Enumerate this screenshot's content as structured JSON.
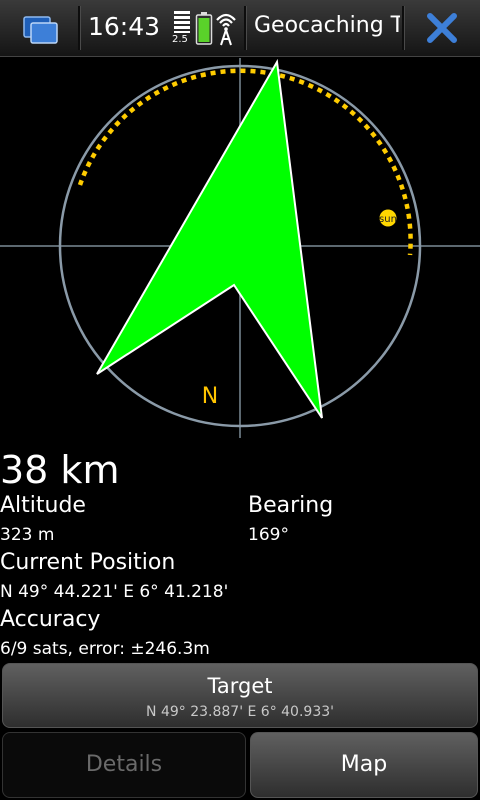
{
  "status_bar": {
    "time": "16:43",
    "signal_label": "2.5",
    "app_title": "Geocaching Too",
    "icons": [
      "task-switcher-icon",
      "signal-strength-icon",
      "battery-icon",
      "wifi-icon",
      "close-icon"
    ],
    "accent_color": "#3d7fd8",
    "battery_color": "#5ad22a"
  },
  "compass": {
    "north_label": "N",
    "sun_label": "sun",
    "arrow_color": "#00ff00",
    "ring_color": "#8a9aa8",
    "satellite_arc_color": "#ffcc00",
    "north_color": "#ffc400"
  },
  "info": {
    "distance": "38 km",
    "altitude_label": "Altitude",
    "altitude_value": "323 m",
    "bearing_label": "Bearing",
    "bearing_value": "169°",
    "position_label": "Current Position",
    "position_value": "N 49° 44.221' E 6° 41.218'",
    "accuracy_label": "Accuracy",
    "accuracy_value": "6/9 sats, error: ±246.3m"
  },
  "buttons": {
    "target_label": "Target",
    "target_coords": "N 49° 23.887' E 6° 40.933'",
    "details_label": "Details",
    "map_label": "Map"
  }
}
